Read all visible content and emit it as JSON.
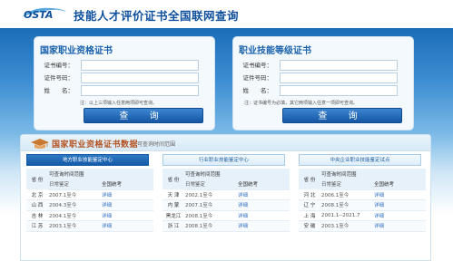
{
  "header": {
    "logo_text": "OSTA",
    "site_title": "技能人才评价证书全国联网查询"
  },
  "panels": {
    "left": {
      "title": "国家职业资格证书",
      "fields": [
        {
          "label": "证书编号：",
          "value": ""
        },
        {
          "label": "证件号码：",
          "value": ""
        },
        {
          "label": "姓　　名：",
          "value": ""
        }
      ],
      "hint": "注：以上三项输入任意两项即可查询。",
      "button": "查 询"
    },
    "right": {
      "title": "职业技能等级证书",
      "fields": [
        {
          "label": "证书编号：",
          "value": ""
        },
        {
          "label": "证件号码：",
          "value": ""
        },
        {
          "label": "姓　　名：",
          "value": ""
        }
      ],
      "hint": "注：证书编号为必填，其它两项输入任意一项即可查询。",
      "button": "查 询"
    }
  },
  "data_section": {
    "title": "国家职业资格证书数据",
    "subtitle": "可查询时间范围",
    "tabs": [
      {
        "label": "地方职业技能鉴定中心",
        "active": true
      },
      {
        "label": "行业职业技能鉴定中心",
        "active": false
      },
      {
        "label": "中央企业职业技能鉴定试点",
        "active": false
      }
    ],
    "table_headers": {
      "province": "省 份",
      "range": "可查询时间范围",
      "daily": "日常鉴定",
      "national": "全国统考"
    },
    "columns": [
      {
        "rows": [
          {
            "province": "北 京",
            "daily": "2007.1至今",
            "national": "详细"
          },
          {
            "province": "山 西",
            "daily": "2004.3至今",
            "national": "详细"
          },
          {
            "province": "吉 林",
            "daily": "2004.1至今",
            "national": "详细"
          },
          {
            "province": "江 苏",
            "daily": "2003.1至今",
            "national": "详细"
          }
        ]
      },
      {
        "rows": [
          {
            "province": "天 津",
            "daily": "2002.1至今",
            "national": "详细"
          },
          {
            "province": "内 蒙",
            "daily": "2007.1至今",
            "national": "详细"
          },
          {
            "province": "黑龙江",
            "daily": "2008.1至今",
            "national": "详细"
          },
          {
            "province": "浙 江",
            "daily": "2008.1至今",
            "national": "详细"
          }
        ]
      },
      {
        "rows": [
          {
            "province": "河 北",
            "daily": "2006.1至今",
            "national": "详细"
          },
          {
            "province": "辽 宁",
            "daily": "2008.1至今",
            "national": "详细"
          },
          {
            "province": "上 海",
            "daily": "2001.1--2021.7",
            "national": "详细"
          },
          {
            "province": "安 徽",
            "daily": "2003.1至今",
            "national": "详细"
          }
        ]
      }
    ]
  }
}
